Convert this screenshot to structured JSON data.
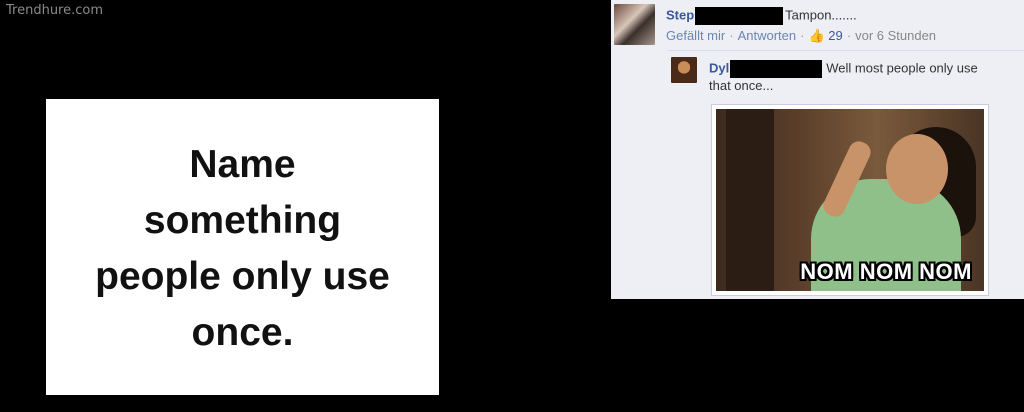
{
  "watermark": "Trendhure.com",
  "question": {
    "line1": "Name",
    "line2": "something",
    "line3": "people only use",
    "line4": "once."
  },
  "comment1": {
    "name": "Step",
    "text": "Tampon.......",
    "like": "Gefällt mir",
    "reply": "Antworten",
    "like_icon": "👍",
    "like_count": "29",
    "time": "vor 6 Stunden"
  },
  "comment2": {
    "name": "Dyl",
    "text_line1": "Well most people only use",
    "text_line2": "that once...",
    "image_caption": "NOM NOM NOM"
  },
  "colors": {
    "fb_link": "#3b5998",
    "panel_bg": "#edeff4"
  }
}
